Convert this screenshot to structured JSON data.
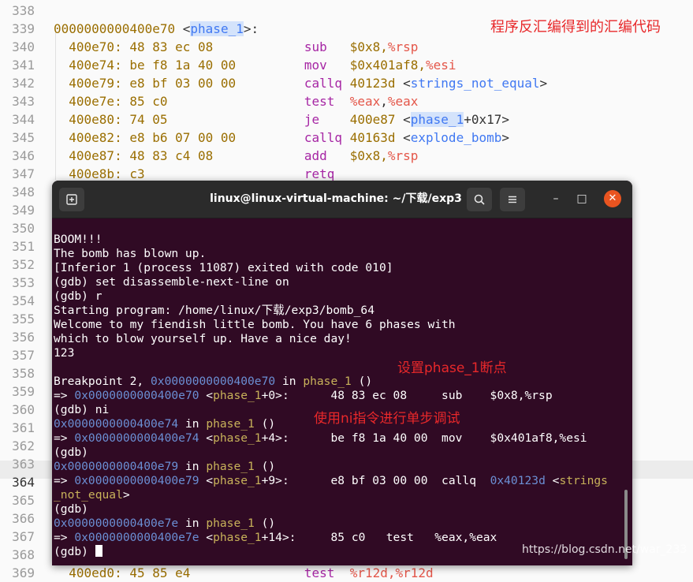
{
  "editor": {
    "annotation": "程序反汇编得到的汇编代码",
    "gutter": [
      "338",
      "339",
      "340",
      "341",
      "342",
      "343",
      "344",
      "345",
      "346",
      "347",
      "348",
      "349",
      "350",
      "351",
      "352",
      "353",
      "354",
      "355",
      "356",
      "357",
      "358",
      "359",
      "360",
      "361",
      "362",
      "363",
      "364",
      "365",
      "366",
      "367",
      "368",
      "369"
    ],
    "func_header": {
      "addr": "0000000000400e70",
      "name": "phase_1"
    },
    "lines": [
      {
        "addr": "400e70:",
        "bytes": "48 83 ec 08",
        "op": "sub",
        "args": [
          {
            "t": "$0x8,",
            "c": "c-addr"
          },
          {
            "t": "%rsp",
            "c": "c-reg"
          }
        ]
      },
      {
        "addr": "400e74:",
        "bytes": "be f8 1a 40 00",
        "op": "mov",
        "args": [
          {
            "t": "$0x401af8,",
            "c": "c-addr"
          },
          {
            "t": "%esi",
            "c": "c-reg"
          }
        ]
      },
      {
        "addr": "400e79:",
        "bytes": "e8 bf 03 00 00",
        "op": "callq",
        "args": [
          {
            "t": "40123d ",
            "c": "c-addr"
          },
          {
            "t": "<",
            "c": ""
          },
          {
            "t": "strings_not_equal",
            "c": "c-fn"
          },
          {
            "t": ">",
            "c": ""
          }
        ]
      },
      {
        "addr": "400e7e:",
        "bytes": "85 c0",
        "op": "test",
        "args": [
          {
            "t": "%eax",
            "c": "c-reg"
          },
          {
            "t": ",",
            "c": ""
          },
          {
            "t": "%eax",
            "c": "c-reg"
          }
        ]
      },
      {
        "addr": "400e80:",
        "bytes": "74 05",
        "op": "je",
        "args": [
          {
            "t": "400e87 ",
            "c": "c-addr"
          },
          {
            "t": "<",
            "c": ""
          },
          {
            "t": "phase_1",
            "c": "c-fn c-hl"
          },
          {
            "t": "+0x17>",
            "c": ""
          }
        ]
      },
      {
        "addr": "400e82:",
        "bytes": "e8 b6 07 00 00",
        "op": "callq",
        "args": [
          {
            "t": "40163d ",
            "c": "c-addr"
          },
          {
            "t": "<",
            "c": ""
          },
          {
            "t": "explode_bomb",
            "c": "c-fn"
          },
          {
            "t": ">",
            "c": ""
          }
        ]
      },
      {
        "addr": "400e87:",
        "bytes": "48 83 c4 08",
        "op": "add",
        "args": [
          {
            "t": "$0x8,",
            "c": "c-addr"
          },
          {
            "t": "%rsp",
            "c": "c-reg"
          }
        ]
      },
      {
        "addr": "400e8b:",
        "bytes": "c3",
        "op": "retq",
        "args": []
      }
    ],
    "bottom_peek": {
      "addr": "400ed0:",
      "bytes": "45 85 e4",
      "op": "test",
      "args": "%r12d,%r12d"
    }
  },
  "terminal": {
    "title": "linux@linux-virtual-machine: ~/下载/exp3",
    "minimize_icon": "–",
    "maximize_icon": "□",
    "close_icon": "✕",
    "annotations": {
      "breakpoint": "设置phase_1断点",
      "ni": "使用ni指令进行单步调试"
    },
    "lines": [
      [
        {
          "t": "BOOM!!!"
        }
      ],
      [
        {
          "t": "The bomb has blown up."
        }
      ],
      [
        {
          "t": "[Inferior 1 (process 11087) exited with code 010]"
        }
      ],
      [
        {
          "t": "(gdb) set disassemble-next-line on"
        }
      ],
      [
        {
          "t": "(gdb) r"
        }
      ],
      [
        {
          "t": "Starting program: /home/linux/下载/exp3/bomb_64"
        }
      ],
      [
        {
          "t": "Welcome to my fiendish little bomb. You have 6 phases with"
        }
      ],
      [
        {
          "t": "which to blow yourself up. Have a nice day!"
        }
      ],
      [
        {
          "t": "123"
        }
      ],
      [
        {
          "t": ""
        }
      ],
      [
        {
          "t": "Breakpoint 2, "
        },
        {
          "t": "0x0000000000400e70",
          "c": "t-addr"
        },
        {
          "t": " in "
        },
        {
          "t": "phase_1",
          "c": "t-fn"
        },
        {
          "t": " ()"
        }
      ],
      [
        {
          "t": "=> "
        },
        {
          "t": "0x0000000000400e70",
          "c": "t-addr"
        },
        {
          "t": " <"
        },
        {
          "t": "phase_1",
          "c": "t-hl"
        },
        {
          "t": "+0>:      48 83 ec 08     sub    $0x8,%rsp"
        }
      ],
      [
        {
          "t": "(gdb) ni"
        }
      ],
      [
        {
          "t": "0x0000000000400e74",
          "c": "t-addr"
        },
        {
          "t": " in "
        },
        {
          "t": "phase_1",
          "c": "t-fn"
        },
        {
          "t": " ()"
        }
      ],
      [
        {
          "t": "=> "
        },
        {
          "t": "0x0000000000400e74",
          "c": "t-addr"
        },
        {
          "t": " <"
        },
        {
          "t": "phase_1",
          "c": "t-hl"
        },
        {
          "t": "+4>:      be f8 1a 40 00  mov    $0x401af8,%esi"
        }
      ],
      [
        {
          "t": "(gdb)"
        }
      ],
      [
        {
          "t": "0x0000000000400e79",
          "c": "t-addr"
        },
        {
          "t": " in "
        },
        {
          "t": "phase_1",
          "c": "t-fn"
        },
        {
          "t": " ()"
        }
      ],
      [
        {
          "t": "=> "
        },
        {
          "t": "0x0000000000400e79",
          "c": "t-addr"
        },
        {
          "t": " <"
        },
        {
          "t": "phase_1",
          "c": "t-hl"
        },
        {
          "t": "+9>:      e8 bf 03 00 00  callq  "
        },
        {
          "t": "0x40123d",
          "c": "t-addr"
        },
        {
          "t": " <"
        },
        {
          "t": "strings",
          "c": "t-hl"
        }
      ],
      [
        {
          "t": "_not_equal",
          "c": "t-hl"
        },
        {
          "t": ">"
        }
      ],
      [
        {
          "t": "(gdb)"
        }
      ],
      [
        {
          "t": "0x0000000000400e7e",
          "c": "t-addr"
        },
        {
          "t": " in "
        },
        {
          "t": "phase_1",
          "c": "t-fn"
        },
        {
          "t": " ()"
        }
      ],
      [
        {
          "t": "=> "
        },
        {
          "t": "0x0000000000400e7e",
          "c": "t-addr"
        },
        {
          "t": " <"
        },
        {
          "t": "phase_1",
          "c": "t-hl"
        },
        {
          "t": "+14>:     85 c0   test   %eax,%eax"
        }
      ],
      [
        {
          "t": "(gdb) "
        }
      ]
    ]
  },
  "watermark": "https://blog.csdn.net/war_233"
}
